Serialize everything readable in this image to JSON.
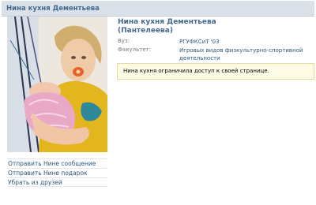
{
  "header": {
    "title": "Нина кухня Дементьева"
  },
  "profile": {
    "name_line1": "Нина кухня Дементьева",
    "name_line2": "(Пантелеева)",
    "info": [
      {
        "label": "Вуз:",
        "value": "РГУФКСиТ '03"
      },
      {
        "label": "Факультет:",
        "value": "Игровых видов физкультурно-спортивной деятельности"
      }
    ],
    "notice": "Нина кухня ограничила доступ к своей странице."
  },
  "actions": [
    {
      "label": "Отправить Нине сообщение"
    },
    {
      "label": "Отправить Нине подарок"
    },
    {
      "label": "Убрать из друзей"
    }
  ],
  "photo": {
    "subject": "avatar-photo"
  },
  "colors": {
    "accent": "#45688e",
    "link": "#2b587a",
    "header_bg": "#dae1e8",
    "notice_bg": "#fdfbe5",
    "notice_border": "#e4dc9f"
  }
}
